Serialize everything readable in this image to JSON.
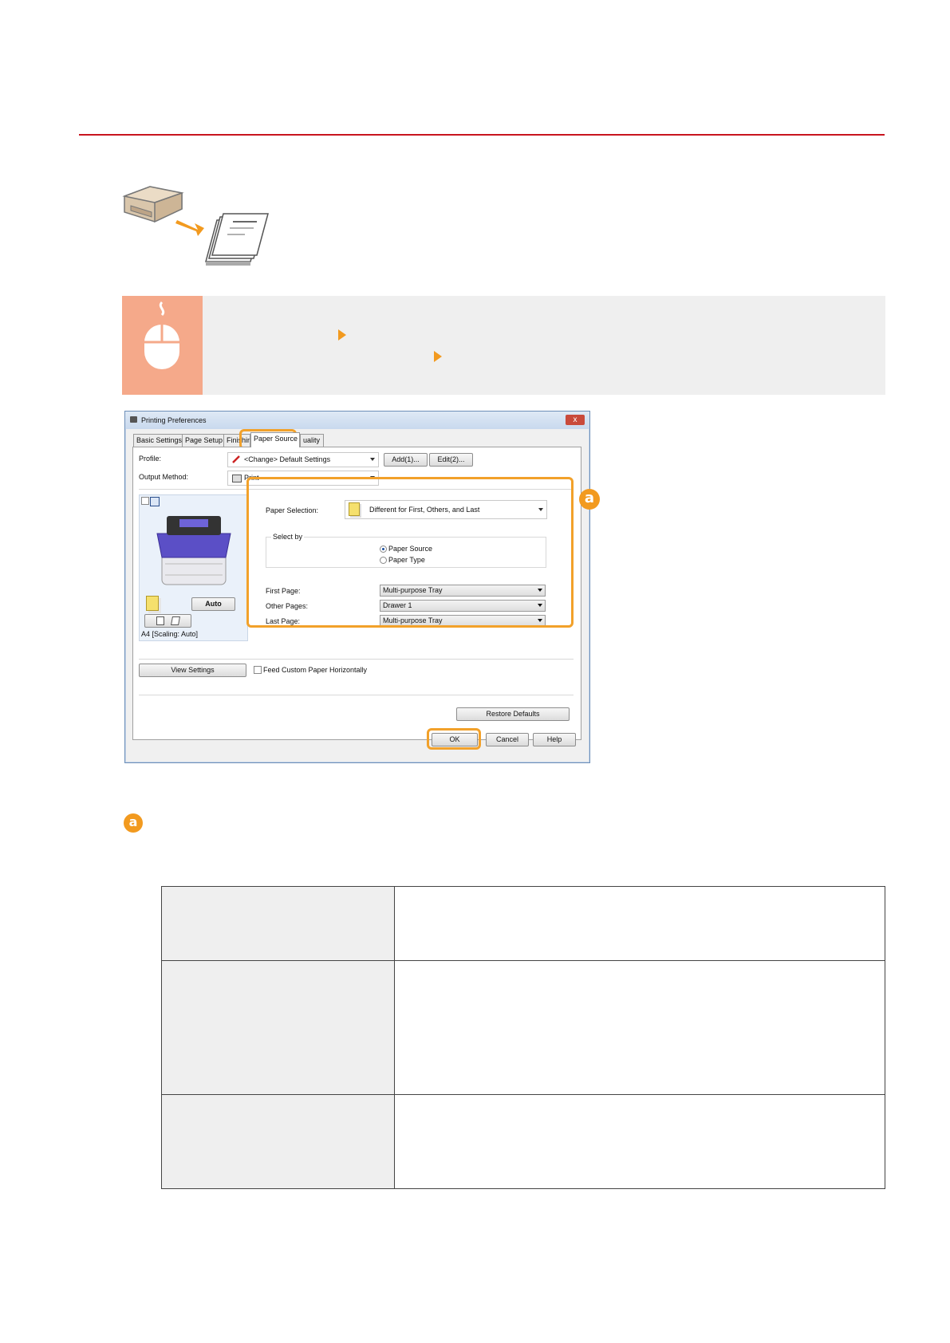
{
  "dialog": {
    "title": "Printing Preferences",
    "close": "x",
    "tabs": [
      "Basic Settings",
      "Page Setup",
      "Finishin",
      "Paper Source",
      "uality"
    ],
    "profile_label": "Profile:",
    "profile_value": "<Change> Default Settings",
    "add_button": "Add(1)...",
    "edit_button": "Edit(2)...",
    "output_method_label": "Output Method:",
    "output_method_value": "Print",
    "paper_selection_label": "Paper Selection:",
    "paper_selection_value": "Different for First, Others, and Last",
    "select_by_label": "Select by",
    "select_by_options": [
      "Paper Source",
      "Paper Type"
    ],
    "first_page_label": "First Page:",
    "first_page_value": "Multi-purpose Tray",
    "other_pages_label": "Other Pages:",
    "other_pages_value": "Drawer 1",
    "last_page_label": "Last Page:",
    "last_page_value": "Multi-purpose Tray",
    "auto_button": "Auto",
    "paper_size_caption": "A4 [Scaling: Auto]",
    "view_settings_button": "View Settings",
    "feed_custom_label": "Feed Custom Paper Horizontally",
    "restore_defaults_button": "Restore Defaults",
    "ok_button": "OK",
    "cancel_button": "Cancel",
    "help_button": "Help"
  },
  "callouts": {
    "a": "a"
  },
  "colors": {
    "accent": "#f29a1f",
    "rule": "#c8141e",
    "badge": "#f5a98a",
    "panel": "#efefef"
  }
}
